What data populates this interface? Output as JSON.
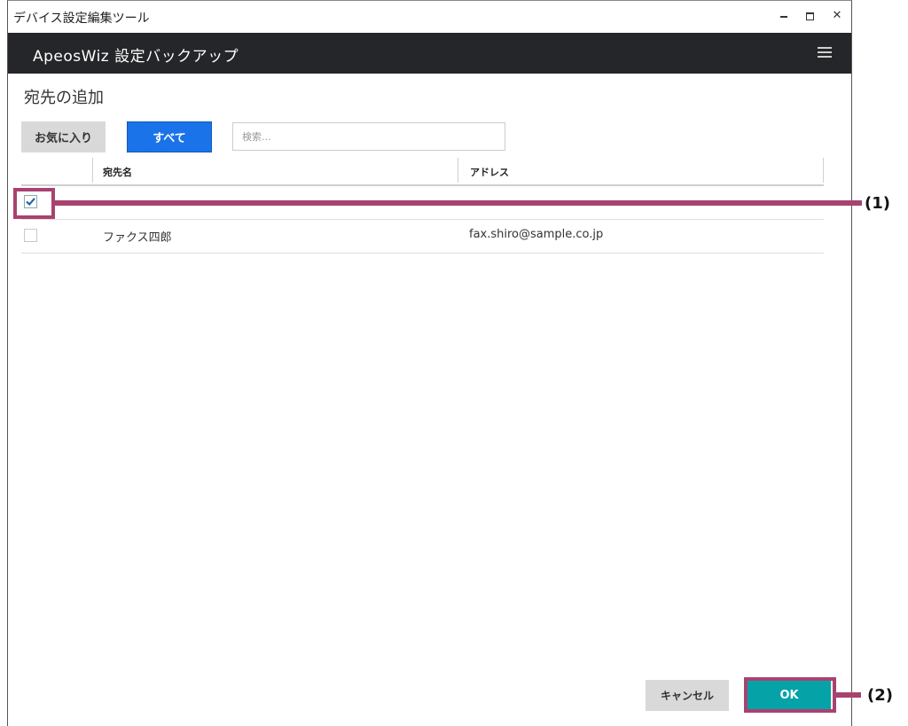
{
  "window": {
    "title": "デバイス設定編集ツール"
  },
  "appbar": {
    "title": "ApeosWiz 設定バックアップ",
    "menu_icon": "hamburger-menu-icon"
  },
  "page": {
    "title": "宛先の追加"
  },
  "filters": {
    "favorites_label": "お気に入り",
    "all_label": "すべて",
    "all_active": true,
    "search_placeholder": "検索..."
  },
  "table": {
    "columns": [
      "宛先名",
      "アドレス"
    ],
    "rows": [
      {
        "name": "",
        "address": "",
        "checked": true
      },
      {
        "name": "ファクス四郎",
        "address": "fax.shiro@sample.co.jp",
        "checked": false
      }
    ]
  },
  "footer": {
    "cancel_label": "キャンセル",
    "ok_label": "OK"
  },
  "callouts": {
    "one": "(1)",
    "two": "(2)"
  },
  "colors": {
    "appbar_bg": "#252629",
    "primary_blue": "#1a73e8",
    "ok_teal": "#05a2a8",
    "callout": "#a8426f"
  }
}
